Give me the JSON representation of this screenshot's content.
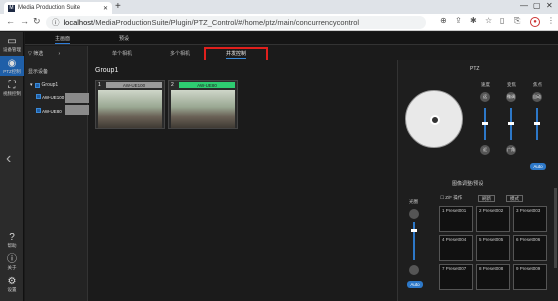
{
  "browser": {
    "tab_title": "Media Production Suite",
    "tab_favicon": "M",
    "url_host": "localhost",
    "url_path": "/MediaProductionSuite/Plugin/PTZ_Control/#/home/ptz/main/concurrencycontrol"
  },
  "left_sidebar": {
    "items": [
      {
        "label": "设备管理",
        "icon": "monitor-icon"
      },
      {
        "label": "PTZ控制",
        "icon": "camera-user-icon"
      },
      {
        "label": "视频控制",
        "icon": "video-icon"
      },
      {
        "label": "帮助",
        "icon": "help-icon"
      },
      {
        "label": "关于",
        "icon": "info-icon"
      },
      {
        "label": "设置",
        "icon": "gear-icon"
      }
    ]
  },
  "top_nav": {
    "tabs": [
      {
        "label": "主画面"
      },
      {
        "label": "预设"
      }
    ]
  },
  "sub_nav": {
    "tabs": [
      {
        "label": "单个相机"
      },
      {
        "label": "多个相机"
      },
      {
        "label": "并发控制"
      }
    ]
  },
  "device_panel": {
    "filter_label": "筛选",
    "section_label": "显示设备",
    "group_label": "Group1",
    "devices": [
      {
        "label": "AW-UE100"
      },
      {
        "label": "AW-UE80"
      }
    ]
  },
  "main": {
    "group_title": "Group1",
    "cameras": [
      {
        "num": "1",
        "name": "AW-UE100",
        "color": "#9a9a9a"
      },
      {
        "num": "2",
        "name": "AW-UE80",
        "color": "#2ecc71"
      }
    ]
  },
  "ptz": {
    "title": "PTZ",
    "labels": [
      "速度",
      "变焦",
      "焦点"
    ],
    "buttons": [
      "远",
      "微调",
      "自动",
      "近",
      "广角"
    ],
    "auto_label": "Auto",
    "preset_section": "图像调整/预设",
    "left_label": "光圈",
    "mode_label": "Z/F 操作",
    "reset_label": "刷新",
    "mode_btn": "模式",
    "presets": [
      {
        "num": "1",
        "name": "Preset001"
      },
      {
        "num": "2",
        "name": "Preset002"
      },
      {
        "num": "3",
        "name": "Preset003"
      },
      {
        "num": "4",
        "name": "Preset004"
      },
      {
        "num": "5",
        "name": "Preset005"
      },
      {
        "num": "6",
        "name": "Preset006"
      },
      {
        "num": "7",
        "name": "Preset007"
      },
      {
        "num": "8",
        "name": "Preset008"
      },
      {
        "num": "9",
        "name": "Preset009"
      }
    ]
  }
}
